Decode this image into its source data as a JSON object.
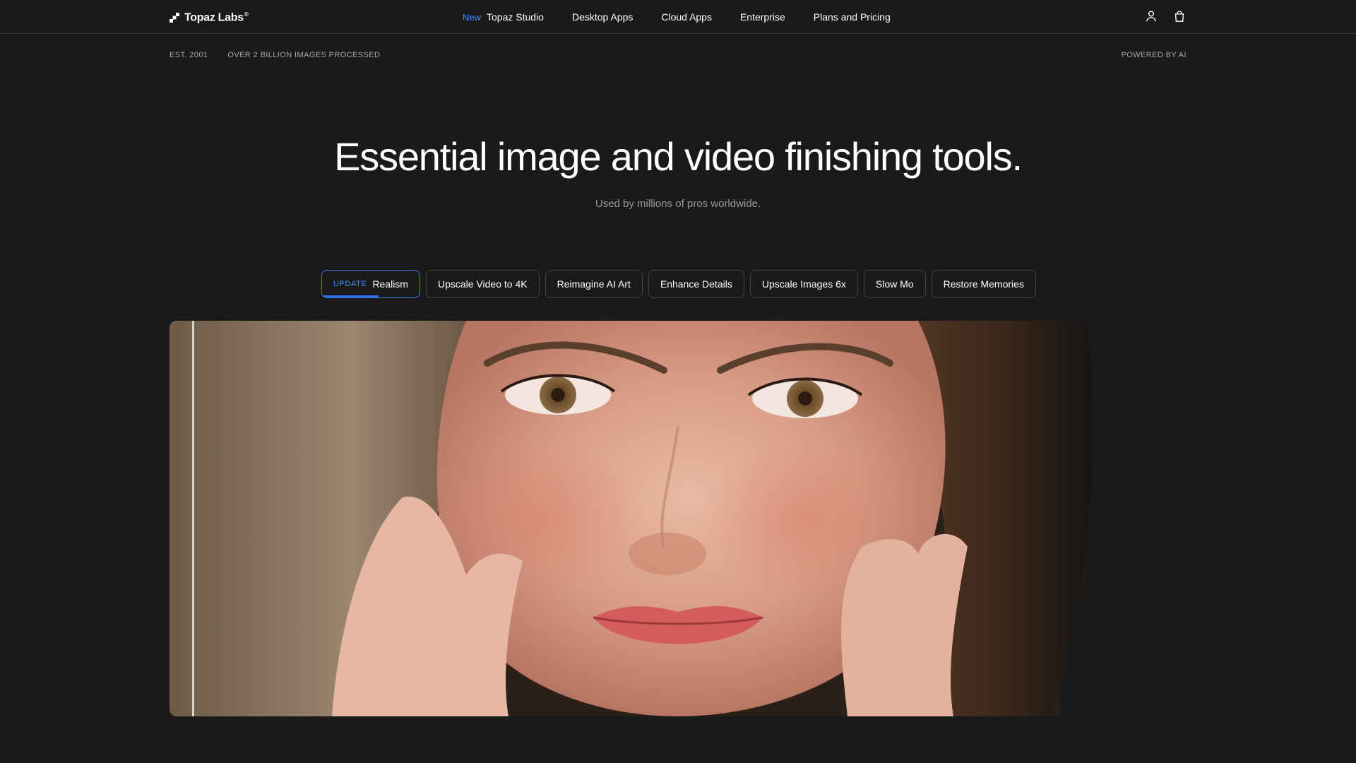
{
  "brand": {
    "name": "Topaz Labs",
    "trademark": "®"
  },
  "nav": {
    "items": [
      {
        "badge": "New",
        "label": "Topaz Studio"
      },
      {
        "label": "Desktop Apps"
      },
      {
        "label": "Cloud Apps"
      },
      {
        "label": "Enterprise"
      },
      {
        "label": "Plans and Pricing"
      }
    ],
    "icons": [
      "user-icon",
      "shopping-bag-icon"
    ],
    "accent_color": "#3d8bff"
  },
  "meta": {
    "established": "EST. 2001",
    "images_processed": "OVER 2 BILLION IMAGES PROCESSED",
    "powered_by": "POWERED BY AI"
  },
  "hero": {
    "title": "Essential image and video finishing tools.",
    "subtitle": "Used by millions of pros worldwide."
  },
  "tabs": {
    "active_index": 0,
    "active_progress": 0.58,
    "items": [
      {
        "badge": "UPDATE",
        "label": "Realism"
      },
      {
        "label": "Upscale Video to 4K"
      },
      {
        "label": "Reimagine AI Art"
      },
      {
        "label": "Enhance Details"
      },
      {
        "label": "Upscale Images 6x"
      },
      {
        "label": "Slow Mo"
      },
      {
        "label": "Restore Memories"
      }
    ]
  },
  "showcase": {
    "image_subject": "close-up portrait of a freckled woman resting her face on her hands",
    "compare_slider_position": 0.02
  }
}
